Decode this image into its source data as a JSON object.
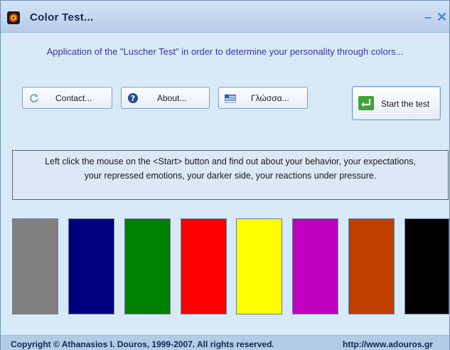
{
  "window": {
    "title": "Color Test...",
    "minimize_glyph": "–",
    "close_glyph": "✕"
  },
  "intro": "Application of the \"Luscher Test\" in order to determine your personality through colors...",
  "buttons": {
    "contact": {
      "label": "Contact...",
      "icon": "refresh-icon"
    },
    "about": {
      "label": "About...",
      "icon": "help-icon"
    },
    "language": {
      "label": "Γλώσσα...",
      "icon": "flag-icon"
    },
    "start": {
      "label": "Start the test",
      "icon": "enter-arrow-icon"
    }
  },
  "info": {
    "line1": "Left click the mouse on the <Start> button and find out about your behavior, your expectations,",
    "line2": "your repressed emotions, your darker side, your reactions under pressure."
  },
  "swatches": [
    {
      "name": "gray",
      "color": "#808080"
    },
    {
      "name": "navy",
      "color": "#000080"
    },
    {
      "name": "green",
      "color": "#008000"
    },
    {
      "name": "red",
      "color": "#ff0000"
    },
    {
      "name": "yellow",
      "color": "#ffff00"
    },
    {
      "name": "magenta",
      "color": "#c000c0"
    },
    {
      "name": "brown",
      "color": "#c04000"
    },
    {
      "name": "black",
      "color": "#000000"
    }
  ],
  "footer": {
    "copyright": "Copyright © Athanasios I. Douros, 1999-2007.  All rights reserved.",
    "website": "http://www.adouros.gr"
  }
}
